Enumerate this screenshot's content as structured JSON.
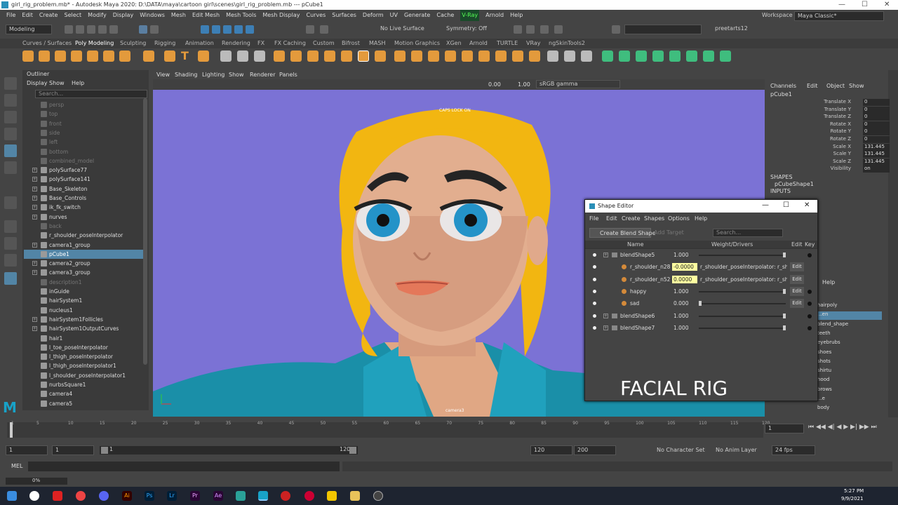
{
  "window": {
    "title": "girl_rig_problem.mb* - Autodesk Maya 2020: D:\\DATA\\maya\\cartoon girl\\scenes\\girl_rig_problem.mb  ---  pCube1",
    "min": "—",
    "max": "☐",
    "close": "✕"
  },
  "menus": [
    "File",
    "Edit",
    "Create",
    "Select",
    "Modify",
    "Display",
    "Windows",
    "Mesh",
    "Edit Mesh",
    "Mesh Tools",
    "Mesh Display",
    "Curves",
    "Surfaces",
    "Deform",
    "UV",
    "Generate",
    "Cache",
    "V-Ray",
    "Arnold",
    "Help"
  ],
  "toolbar": {
    "mode": "Modeling",
    "live_surface": "No Live Surface",
    "symmetry": "Symmetry: Off",
    "user": "preetarts12",
    "workspace_label": "Workspace :",
    "workspace": "Maya Classic*"
  },
  "shelf_tabs": [
    "Curves / Surfaces",
    "Poly Modeling",
    "Sculpting",
    "Rigging",
    "Animation",
    "Rendering",
    "FX",
    "FX Caching",
    "Custom",
    "Bifrost",
    "MASH",
    "Motion Graphics",
    "XGen",
    "Arnold",
    "TURTLE",
    "VRay",
    "ngSkinTools2"
  ],
  "outliner": {
    "title": "Outliner",
    "menu": [
      "Display",
      "Show",
      "Help"
    ],
    "search_placeholder": "Search...",
    "items": [
      {
        "label": "persp",
        "dim": true,
        "exp": false
      },
      {
        "label": "top",
        "dim": true,
        "exp": false
      },
      {
        "label": "front",
        "dim": true,
        "exp": false
      },
      {
        "label": "side",
        "dim": true,
        "exp": false
      },
      {
        "label": "left",
        "dim": true,
        "exp": false
      },
      {
        "label": "bottom",
        "dim": true,
        "exp": false
      },
      {
        "label": "combined_model",
        "dim": true,
        "exp": false
      },
      {
        "label": "polySurface77",
        "dim": false,
        "exp": true
      },
      {
        "label": "polySurface141",
        "dim": false,
        "exp": true
      },
      {
        "label": "Base_Skeleton",
        "dim": false,
        "exp": true
      },
      {
        "label": "Base_Controls",
        "dim": false,
        "exp": true
      },
      {
        "label": "ik_fk_switch",
        "dim": false,
        "exp": true
      },
      {
        "label": "nurves",
        "dim": false,
        "exp": true
      },
      {
        "label": "back",
        "dim": true,
        "exp": false
      },
      {
        "label": "r_shoulder_poseInterpolator",
        "dim": false,
        "exp": false
      },
      {
        "label": "camera1_group",
        "dim": false,
        "exp": true
      },
      {
        "label": "pCube1",
        "dim": false,
        "exp": false,
        "sel": true
      },
      {
        "label": "camera2_group",
        "dim": false,
        "exp": true
      },
      {
        "label": "camera3_group",
        "dim": false,
        "exp": true
      },
      {
        "label": "description1",
        "dim": true,
        "exp": false
      },
      {
        "label": "inGuide",
        "dim": false,
        "exp": false
      },
      {
        "label": "hairSystem1",
        "dim": false,
        "exp": false
      },
      {
        "label": "nucleus1",
        "dim": false,
        "exp": false
      },
      {
        "label": "hairSystem1Follicles",
        "dim": false,
        "exp": true
      },
      {
        "label": "hairSystem1OutputCurves",
        "dim": false,
        "exp": true
      },
      {
        "label": "hair1",
        "dim": false,
        "exp": false
      },
      {
        "label": "l_toe_poseInterpolator",
        "dim": false,
        "exp": false
      },
      {
        "label": "l_thigh_poseInterpolator",
        "dim": false,
        "exp": false
      },
      {
        "label": "l_thigh_poseInterpolator1",
        "dim": false,
        "exp": false
      },
      {
        "label": "l_shoulder_poseInterpolator1",
        "dim": false,
        "exp": false
      },
      {
        "label": "nurbsSquare1",
        "dim": false,
        "exp": false
      },
      {
        "label": "camera4",
        "dim": false,
        "exp": false
      },
      {
        "label": "camera5",
        "dim": false,
        "exp": false
      }
    ]
  },
  "viewport": {
    "menu": [
      "View",
      "Shading",
      "Lighting",
      "Show",
      "Renderer",
      "Panels"
    ],
    "exposure": "0.00",
    "gamma": "1.00",
    "colorspace": "sRGB gamma",
    "caps_lock": "CAPS LOCK ON",
    "camera": "camera3",
    "overlay": "FACIAL RIG",
    "bg_color": "#7b72d5"
  },
  "channel_box": {
    "menu": [
      "Channels",
      "Edit",
      "Object",
      "Show"
    ],
    "object": "pCube1",
    "attrs": [
      {
        "name": "Translate X",
        "value": "0"
      },
      {
        "name": "Translate Y",
        "value": "0"
      },
      {
        "name": "Translate Z",
        "value": "0"
      },
      {
        "name": "Rotate X",
        "value": "0"
      },
      {
        "name": "Rotate Y",
        "value": "0"
      },
      {
        "name": "Rotate Z",
        "value": "0"
      },
      {
        "name": "Scale X",
        "value": "131.445"
      },
      {
        "name": "Scale Y",
        "value": "131.445"
      },
      {
        "name": "Scale Z",
        "value": "131.445"
      },
      {
        "name": "Visibility",
        "value": "on"
      }
    ],
    "shapes_label": "SHAPES",
    "shape": "pCubeShape1",
    "inputs_label": "INPUTS",
    "layer_help": "Help",
    "layers": [
      "hairpoly",
      "...en",
      "blend_shape",
      "teeth",
      "eyebrubs",
      "shoes",
      "shots",
      "shirtu",
      "hood",
      "brows",
      "...e",
      "body"
    ],
    "side_tabs": [
      "Channel Box / Layer Editor",
      "Modeling Toolkit",
      "Attribute Editor",
      "Human IK",
      "XGen",
      "XGen Interactive Groom Editor"
    ]
  },
  "shape_editor": {
    "title": "Shape Editor",
    "menu": [
      "File",
      "Edit",
      "Create",
      "Shapes",
      "Options",
      "Help"
    ],
    "create_btn": "Create Blend Shape",
    "add_target": "Add Target",
    "search_placeholder": "Search...",
    "col_name": "Name",
    "col_weight": "Weight/Drivers",
    "col_edit": "Edit",
    "col_key": "Key",
    "rows": [
      {
        "name": "blendShape5",
        "weight": "1.000",
        "type": "group",
        "slider": 1.0
      },
      {
        "name": "r_shoulder_n28",
        "weight": "-0.0000",
        "driver": "r_shoulder_poseInterpolator: r_shoul",
        "type": "driven"
      },
      {
        "name": "r_shoulder_n52",
        "weight": "0.0000",
        "driver": "r_shoulder_poseInterpolator: r_shoul",
        "type": "driven"
      },
      {
        "name": "happy",
        "weight": "1.000",
        "type": "target",
        "slider": 1.0
      },
      {
        "name": "sad",
        "weight": "0.000",
        "type": "target",
        "slider": 0.0
      },
      {
        "name": "blendShape6",
        "weight": "1.000",
        "type": "group",
        "slider": 1.0
      },
      {
        "name": "blendShape7",
        "weight": "1.000",
        "type": "group",
        "slider": 1.0
      }
    ],
    "edit_label": "Edit"
  },
  "timeline": {
    "ticks": [
      "1",
      "5",
      "10",
      "15",
      "20",
      "25",
      "30",
      "35",
      "40",
      "45",
      "50",
      "55",
      "60",
      "65",
      "70",
      "75",
      "80",
      "85",
      "90",
      "95",
      "100",
      "105",
      "110",
      "115",
      "120"
    ],
    "current": "1"
  },
  "range": {
    "start": "1",
    "start2": "1",
    "range_start": "1",
    "range_end": "120",
    "end": "120",
    "end2": "200",
    "char_set": "No Character Set",
    "anim_layer": "No Anim Layer",
    "fps": "24 fps"
  },
  "mel": {
    "label": "MEL"
  },
  "status": {
    "progress": "0%"
  },
  "taskbar": {
    "time": "5:27 PM",
    "date": "9/9/2021"
  }
}
